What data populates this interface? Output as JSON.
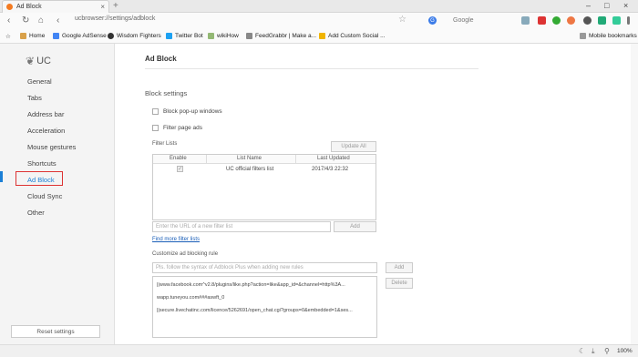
{
  "browser": {
    "tab_title": "Ad Block",
    "tab_close": "×",
    "new_tab": "+",
    "url": "ucbrowser://settings/adblock",
    "search_engine_letter": "G",
    "search_placeholder": "Google",
    "nav": {
      "back": "‹",
      "forward": "›",
      "reload": "↻",
      "home": "⌂"
    },
    "win": {
      "min": "–",
      "max": "□",
      "close": "×"
    }
  },
  "bookmarks": [
    {
      "label": "Home",
      "color": "#d9a14a"
    },
    {
      "label": "Google AdSense",
      "color": "#4285f4"
    },
    {
      "label": "Wisdom Fighters",
      "color": "#333333"
    },
    {
      "label": "Twitter Bot",
      "color": "#1da1f2"
    },
    {
      "label": "wikiHow",
      "color": "#93b874"
    },
    {
      "label": "FeedGrabbr | Make a...",
      "color": "#888888"
    },
    {
      "label": "Add Custom Social ...",
      "color": "#f0b400"
    }
  ],
  "mobile_bookmarks": "Mobile bookmarks",
  "sidebar": {
    "logo_text": "UC",
    "items": [
      "General",
      "Tabs",
      "Address bar",
      "Acceleration",
      "Mouse gestures",
      "Shortcuts",
      "Ad Block",
      "Cloud Sync",
      "Other"
    ],
    "active_index": 6,
    "reset_button": "Reset settings"
  },
  "main": {
    "title": "Ad Block",
    "block_settings": "Block settings",
    "block_popups": "Block pop-up windows",
    "filter_page_ads": "Filter page ads",
    "filter_lists_label": "Filter Lists",
    "update_all": "Update All",
    "table": {
      "headers": [
        "Enable",
        "List Name",
        "Last Updated"
      ],
      "rows": [
        {
          "enabled": "✓",
          "name": "UC official filters list",
          "updated": "2017/4/3 22:32"
        }
      ]
    },
    "url_input_placeholder": "Enter the URL of a new filter list",
    "add_label": "Add",
    "find_more": "Find more filter lists",
    "customize_label": "Customize ad blocking rule",
    "rule_input_placeholder": "Pls. follow the syntax of Adblock Plus when adding new rules",
    "add_rule_label": "Add",
    "delete_label": "Delete",
    "rules": [
      "||www.facebook.com^v2.8/plugins/like.php?action=like&app_id=&channel=http%3A...",
      "wapp.tuneyou.com###aswft_0",
      "||secure.livechatinc.com/licence/5262691/open_chat.cgi?groups=0&embedded=1&ses..."
    ]
  },
  "status": {
    "zoom": "100%"
  }
}
